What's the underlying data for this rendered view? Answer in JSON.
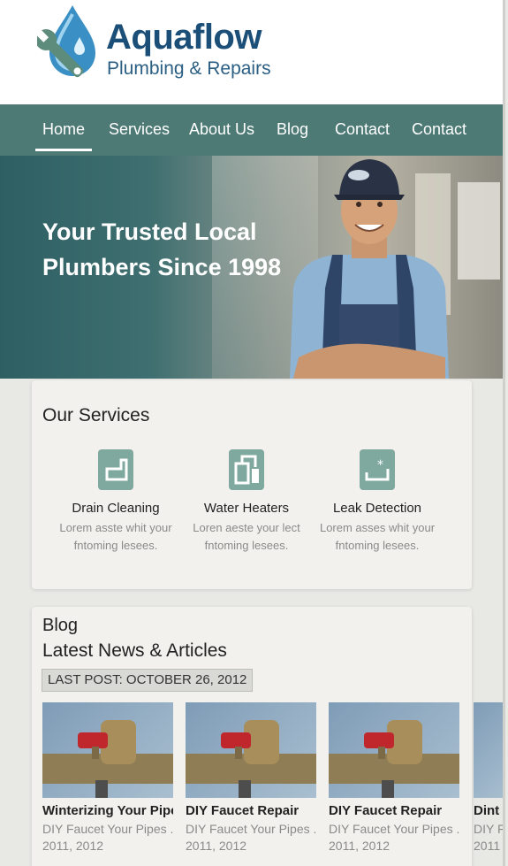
{
  "brand": {
    "name": "Aquaflow",
    "tagline": "Plumbing & Repairs"
  },
  "nav": {
    "items": [
      {
        "label": "Home",
        "active": true
      },
      {
        "label": "Services"
      },
      {
        "label": "About Us"
      },
      {
        "label": "Blog"
      },
      {
        "label": "Contact"
      },
      {
        "label": "Contact"
      }
    ]
  },
  "hero": {
    "title": "Your Trusted Local Plumbers Since 1998"
  },
  "services": {
    "title": "Our Services",
    "items": [
      {
        "name": "Drain Cleaning",
        "desc_line1": "Lorem asste whit your",
        "desc_line2": "fntoming lesees.",
        "icon": "drain-icon"
      },
      {
        "name": "Water Heaters",
        "desc_line1": "Loren aeste your lect",
        "desc_line2": "fntoming lesees.",
        "icon": "water-heater-icon"
      },
      {
        "name": "Leak Detection",
        "desc_line1": "Lorem asses whit your",
        "desc_line2": "fntoming lesees.",
        "icon": "leak-icon"
      }
    ]
  },
  "blog": {
    "label": "Blog",
    "heading": "Latest News & Articles",
    "last_post": "LAST POST: OCTOBER 26, 2012",
    "posts": [
      {
        "title": "Winterizing Your Pipes",
        "excerpt": "DIY Faucet Your Pipes ...",
        "date": "2011, 2012"
      },
      {
        "title": "DIY Faucet Repair",
        "excerpt": "DIY Faucet Your Pipes ...",
        "date": "2011, 2012"
      },
      {
        "title": "DIY Faucet Repair",
        "excerpt": "DIY Faucet Your Pipes ...",
        "date": "2011, 2012"
      },
      {
        "title": "Dint",
        "excerpt": "DIY F",
        "date": "2011"
      }
    ]
  },
  "colors": {
    "nav": "#4e7a76",
    "brand": "#1b4f78",
    "accent": "#7fa89e"
  }
}
